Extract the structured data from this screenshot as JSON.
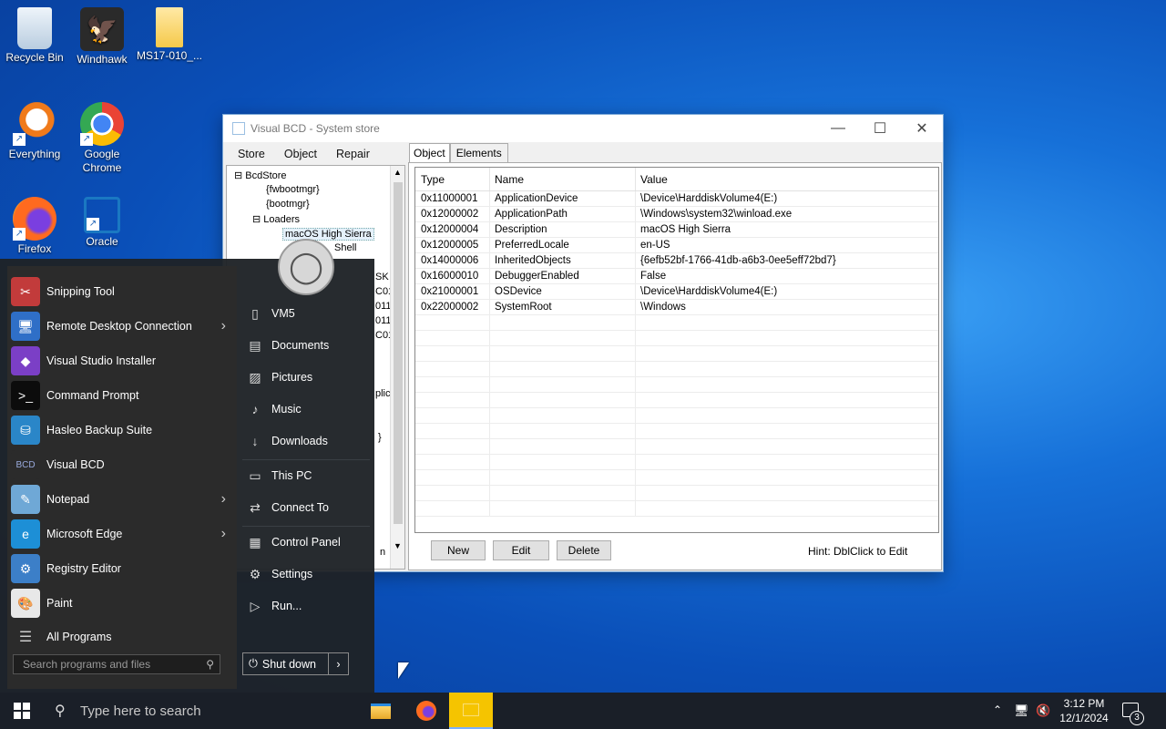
{
  "desktop": {
    "icons": [
      {
        "label": "Recycle Bin"
      },
      {
        "label": "Windhawk"
      },
      {
        "label": "MS17-010_..."
      },
      {
        "label": "Everything"
      },
      {
        "label": "Google Chrome"
      },
      {
        "label": "Firefox"
      },
      {
        "label": "Oracle"
      }
    ]
  },
  "window": {
    "title": "Visual BCD - System store",
    "menu": [
      "Store",
      "Object",
      "Repair"
    ],
    "tree": [
      "BcdStore",
      "{fwbootmgr}",
      "{bootmgr}",
      "Loaders",
      "macOS High Sierra",
      "Shell"
    ],
    "tree_partial": [
      "SK",
      "C01",
      "011",
      "011",
      "C01",
      "plic",
      "}",
      "n"
    ],
    "tabs": [
      "Object",
      "Elements"
    ],
    "columns": [
      "Type",
      "Name",
      "Value"
    ],
    "rows": [
      {
        "type": "0x11000001",
        "name": "ApplicationDevice",
        "value": "\\Device\\HarddiskVolume4(E:)"
      },
      {
        "type": "0x12000002",
        "name": "ApplicationPath",
        "value": "\\Windows\\system32\\winload.exe"
      },
      {
        "type": "0x12000004",
        "name": "Description",
        "value": "macOS High Sierra"
      },
      {
        "type": "0x12000005",
        "name": "PreferredLocale",
        "value": "en-US"
      },
      {
        "type": "0x14000006",
        "name": "InheritedObjects",
        "value": "{6efb52bf-1766-41db-a6b3-0ee5eff72bd7}"
      },
      {
        "type": "0x16000010",
        "name": "DebuggerEnabled",
        "value": "False"
      },
      {
        "type": "0x21000001",
        "name": "OSDevice",
        "value": "\\Device\\HarddiskVolume4(E:)"
      },
      {
        "type": "0x22000002",
        "name": "SystemRoot",
        "value": "\\Windows"
      }
    ],
    "buttons": {
      "new": "New",
      "edit": "Edit",
      "delete": "Delete"
    },
    "hint": "Hint: DblClick to Edit"
  },
  "start_menu": {
    "programs": [
      {
        "label": "Snipping Tool",
        "arrow": false
      },
      {
        "label": "Remote Desktop Connection",
        "arrow": true
      },
      {
        "label": "Visual Studio Installer",
        "arrow": false
      },
      {
        "label": "Command Prompt",
        "arrow": false
      },
      {
        "label": "Hasleo Backup Suite",
        "arrow": false
      },
      {
        "label": "Visual BCD",
        "arrow": false
      },
      {
        "label": "Notepad",
        "arrow": true
      },
      {
        "label": "Microsoft Edge",
        "arrow": true
      },
      {
        "label": "Registry Editor",
        "arrow": false
      },
      {
        "label": "Paint",
        "arrow": false
      }
    ],
    "all_programs": "All Programs",
    "search_placeholder": "Search programs and files",
    "places": [
      "VM5",
      "Documents",
      "Pictures",
      "Music",
      "Downloads",
      "This PC",
      "Connect To",
      "Control Panel",
      "Settings",
      "Run..."
    ],
    "shutdown": "Shut down"
  },
  "taskbar": {
    "search_placeholder": "Type here to search",
    "time": "3:12 PM",
    "date": "12/1/2024",
    "notifications": "3"
  },
  "colors": {
    "accent": "#0a64d6",
    "taskbar": "#1a1f28",
    "start_bg": "#1e2226"
  }
}
